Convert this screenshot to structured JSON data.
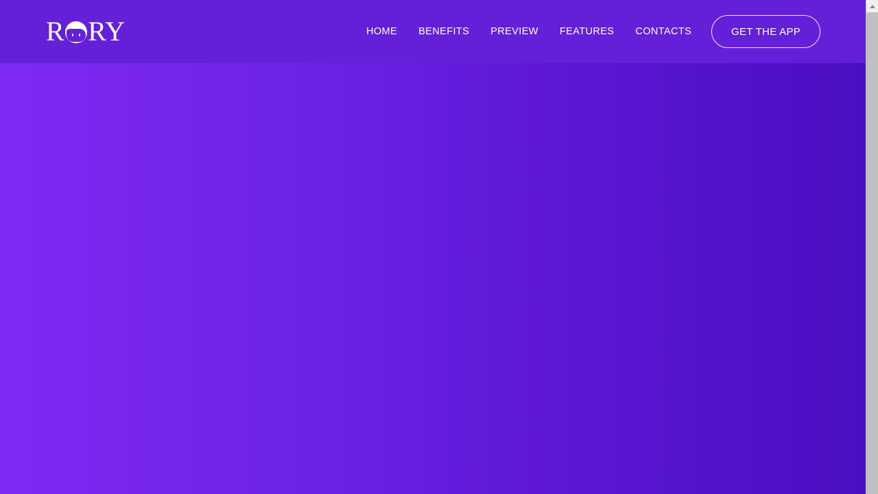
{
  "site": {
    "brand": {
      "name": "RORY",
      "letters_before": "R",
      "letters_after": "RY",
      "mark_icon": "cat-face-circle-icon"
    },
    "theme": {
      "header_bg": "#6320d8",
      "hero_gradient_start": "#7f29f5",
      "hero_gradient_end": "#4a0fc0",
      "text_color": "#ffffff",
      "cta_border": "#ffffff"
    }
  },
  "header": {
    "nav": [
      {
        "label": "HOME"
      },
      {
        "label": "BENEFITS"
      },
      {
        "label": "PREVIEW"
      },
      {
        "label": "FEATURES"
      },
      {
        "label": "CONTACTS"
      }
    ],
    "cta": {
      "label": "GET THE APP"
    }
  },
  "hero": {
    "content": ""
  },
  "scrollbar": {
    "up_arrow_icon": "triangle-up-icon",
    "position": "top"
  }
}
